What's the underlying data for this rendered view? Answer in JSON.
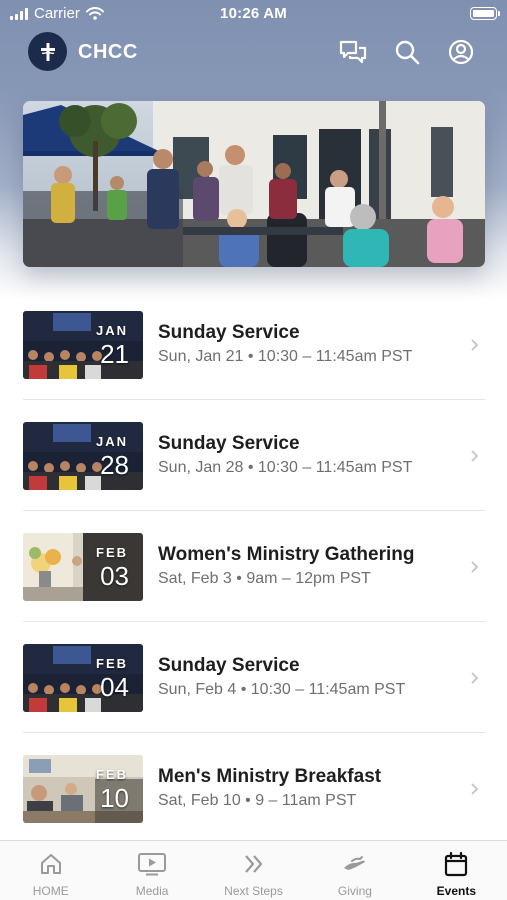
{
  "status_bar": {
    "carrier": "Carrier",
    "time": "10:26 AM"
  },
  "app_bar": {
    "title": "CHCC"
  },
  "events": [
    {
      "month": "JAN",
      "day": "21",
      "title": "Sunday Service",
      "meta": "Sun, Jan 21 • 10:30 – 11:45am PST",
      "image": "worship"
    },
    {
      "month": "JAN",
      "day": "28",
      "title": "Sunday Service",
      "meta": "Sun, Jan 28 • 10:30 – 11:45am PST",
      "image": "worship"
    },
    {
      "month": "FEB",
      "day": "03",
      "title": "Women's Ministry Gathering",
      "meta": "Sat, Feb 3 • 9am – 12pm PST",
      "image": "flowers"
    },
    {
      "month": "FEB",
      "day": "04",
      "title": "Sunday Service",
      "meta": "Sun, Feb 4 • 10:30 – 11:45am PST",
      "image": "worship"
    },
    {
      "month": "FEB",
      "day": "10",
      "title": "Men's Ministry Breakfast",
      "meta": "Sat, Feb 10 • 9 – 11am PST",
      "image": "breakfast"
    }
  ],
  "tabs": [
    {
      "label": "HOME",
      "icon": "home-icon"
    },
    {
      "label": "Media",
      "icon": "media-icon"
    },
    {
      "label": "Next Steps",
      "icon": "next-steps-icon"
    },
    {
      "label": "Giving",
      "icon": "giving-icon"
    },
    {
      "label": "Events",
      "icon": "events-icon",
      "active": true
    }
  ],
  "colors": {
    "header": "#8797b6",
    "logo": "#1c2b4c",
    "active_tab": "#111111",
    "inactive_tab": "#9a9a9a"
  }
}
